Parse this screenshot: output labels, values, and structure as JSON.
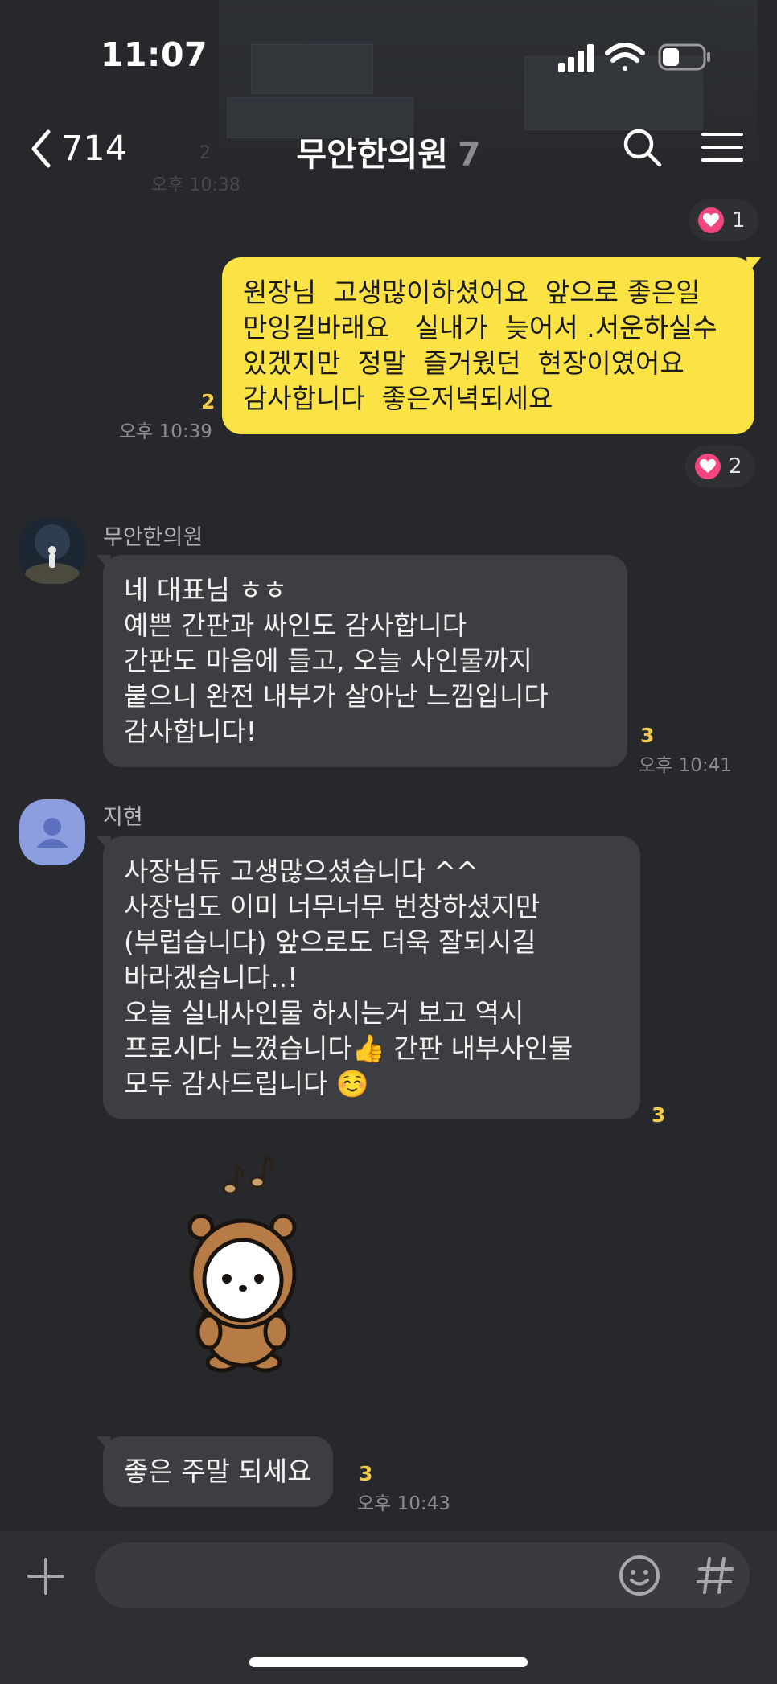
{
  "status_bar": {
    "time": "11:07"
  },
  "header": {
    "back_count": "714",
    "title": "무안한의원",
    "member_count": "7",
    "ghost_unread": "2",
    "ghost_time": "오후 10:38"
  },
  "messages": [
    {
      "type": "mine",
      "reaction_above": {
        "count": "1"
      },
      "text": "원장님  고생많이하셨어요  앞으로 좋은일 만잉길바래요   실내가  늦어서 .서운하실수 있겠지만  정말  즐거웠던  현장이였어요 감사합니다  좋은저녁되세요",
      "unread": "2",
      "time": "오후 10:39",
      "reaction_below": {
        "count": "2"
      }
    },
    {
      "type": "theirs",
      "sender": "무안한의원",
      "text": "네 대표님 ㅎㅎ\n예쁜 간판과 싸인도 감사합니다\n간판도 마음에 들고, 오늘 사인물까지 붙으니 완전 내부가 살아난 느낌입니다\n감사합니다!",
      "unread": "3",
      "time": "오후 10:41"
    },
    {
      "type": "theirs",
      "sender": "지현",
      "text": "사장님듀 고생많으셨습니다 ^^\n사장님도 이미 너무너무 번창하셨지만(부럽습니다) 앞으로도 더욱 잘되시길 바라겠습니다..!\n오늘 실내사인물 하시는거 보고 역시 프로시다 느꼈습니다👍 간판 내부사인물 모두 감사드립니다 ☺️",
      "unread": "3"
    },
    {
      "type": "sticker",
      "name": "bear-costume-sticker"
    },
    {
      "type": "theirs",
      "text": "좋은 주말 되세요",
      "unread": "3",
      "time": "오후 10:43"
    }
  ],
  "input": {
    "placeholder": ""
  }
}
